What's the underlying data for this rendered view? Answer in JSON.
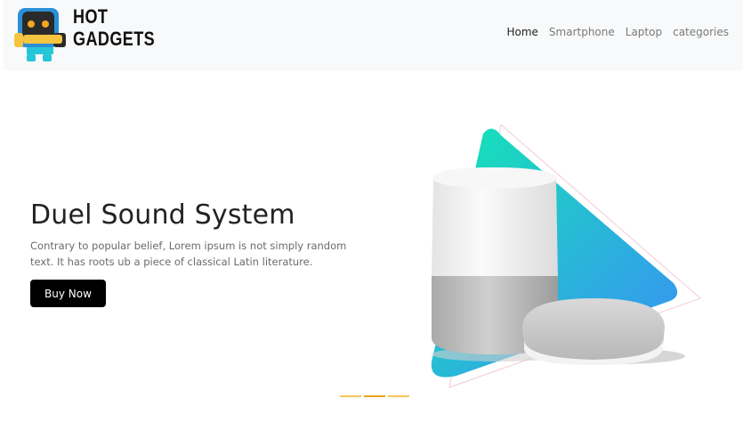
{
  "brand": {
    "line1": "HOT",
    "line2": "GADGETS"
  },
  "nav": {
    "items": [
      {
        "label": "Home",
        "active": true
      },
      {
        "label": "Smartphone",
        "active": false
      },
      {
        "label": "Laptop",
        "active": false
      },
      {
        "label": "categories",
        "active": false
      }
    ]
  },
  "hero": {
    "title": "Duel Sound System",
    "text": "Contrary to popular belief, Lorem ipsum is not simply random text. It has roots ub a piece of classical Latin literature.",
    "button_label": "Buy Now"
  },
  "carousel": {
    "slides": 3,
    "active_index": 1
  },
  "colors": {
    "navbar_bg": "#f8f9fa",
    "button_bg": "#000000",
    "gradient_start": "#14e6b4",
    "gradient_end": "#3a8ef7",
    "indicator": "#f6c65a"
  },
  "icons": {
    "logo": "robot-mascot-logo"
  }
}
